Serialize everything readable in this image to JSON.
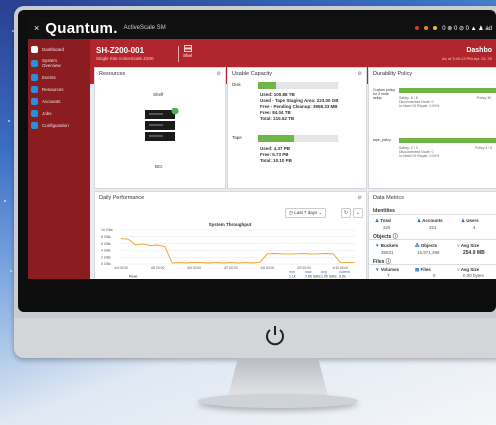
{
  "app": {
    "brand": "Quantum.",
    "product": "ActiveScale SM",
    "close_glyph": "×",
    "status_text": "0 ⊗ 0 ⊘ 0 ▲ ♟ ad"
  },
  "sidebar": {
    "items": [
      {
        "label": "Dashboard",
        "icon": "dashboard-icon"
      },
      {
        "label": "System Overview",
        "icon": "system-icon"
      },
      {
        "label": "Events",
        "icon": "events-icon"
      },
      {
        "label": "Resources",
        "icon": "resources-icon"
      },
      {
        "label": "Accounts",
        "icon": "accounts-icon"
      },
      {
        "label": "Jobs",
        "icon": "jobs-icon"
      },
      {
        "label": "Configuration",
        "icon": "config-icon"
      }
    ]
  },
  "header": {
    "hostname": "SH-Z200-001",
    "subtitle": "Single Site ActiveScale Z200",
    "shelf_label": "Shel",
    "page_title": "Dashbo",
    "as_of": "As of 3:40:13 PM Apr 13, 20"
  },
  "resources": {
    "title": "Resources",
    "unit_label": "Shelf",
    "device_label": "BCI"
  },
  "capacity": {
    "title": "Usable Capacity",
    "disk_label": "Disk",
    "disk_used_fraction": 0.22,
    "disk_lines": [
      "Used: 100.88 TB",
      "Used - Tape Staging Area: 223.00 GB",
      "Free - Pending Cleanup: 3958.33 MB",
      "Free: 84.04 TB",
      "Total: 215.52 TB"
    ],
    "tape_label": "Tape",
    "tape_used_fraction": 0.45,
    "tape_lines": [
      "Used: 4.37 PB",
      "Free: 5.73 PB",
      "Total: 10.10 PB"
    ]
  },
  "durability": {
    "title": "Durability Policy",
    "row1_label": "Custom policy for 3 node setup",
    "row1_detail": [
      "Safety: 6 / 8",
      "Disconnected Node: 0",
      "In-Need Of Repair: 0.00%"
    ],
    "row1_right": "Policy 30",
    "row2_label": "tape_policy",
    "row2_detail": [
      "Safety: 2 / 3",
      "Disconnected Node: 0",
      "In-Need Of Repair: 0.00%"
    ],
    "row2_right": "Policy 4 / 6"
  },
  "performance": {
    "title": "Daily Performance",
    "range_label": "Last 7 days",
    "chart_title": "System Throughput",
    "summary_headers": [
      "min",
      "max",
      "avg",
      "current"
    ],
    "summary_row": {
      "name": "Read",
      "values": [
        "1.1k",
        "7.65 GB/s",
        "1.05 GB/s",
        "0.9x"
      ]
    }
  },
  "metrics": {
    "title": "Data Metrics",
    "identities_label": "Identities",
    "identities": [
      {
        "label": "Total",
        "value": "325"
      },
      {
        "label": "Accounts",
        "value": "321"
      },
      {
        "label": "Users",
        "value": "4"
      }
    ],
    "objects_label": "Objects",
    "objects": [
      {
        "label": "Buckets",
        "value": "35631"
      },
      {
        "label": "Objects",
        "value": "15,971,398"
      },
      {
        "label": "Avg Size",
        "value": "254.9 MB"
      }
    ],
    "files_label": "Files",
    "files": [
      {
        "label": "Volumes",
        "value": "7"
      },
      {
        "label": "Files",
        "value": "0"
      },
      {
        "label": "Avg Size",
        "value": "0.00 bytes"
      }
    ]
  },
  "chart_data": {
    "type": "line",
    "title": "System Throughput",
    "xlabel": "",
    "ylabel": "",
    "x_ticks": [
      "4/4 00:00",
      "4/5 00:00",
      "4/6 00:00",
      "4/7 00:00",
      "4/8 00:00",
      "4/9 00:00",
      "4/10 00:00"
    ],
    "y_ticks": [
      "10 GBs",
      "8 GBs",
      "6 GBs",
      "4 GBs",
      "2 GBs",
      "0 GBs"
    ],
    "ylim": [
      0,
      10
    ],
    "series": [
      {
        "name": "Read",
        "color": "#f0a020",
        "x": [
          0,
          0.2,
          0.4,
          0.6,
          0.8,
          1.0,
          1.2,
          1.4,
          1.6,
          1.8,
          2.0,
          2.2,
          2.4,
          2.6,
          2.8,
          3.0,
          3.2,
          3.4,
          3.6,
          3.8,
          4.0,
          4.2,
          4.4,
          4.6,
          4.8,
          5.0,
          5.2,
          5.4,
          5.6,
          5.8,
          6.0,
          6.2,
          6.4
        ],
        "values": [
          7.5,
          7.3,
          5.6,
          5.9,
          5.4,
          5.6,
          5.1,
          0.3,
          0.4,
          0.3,
          0.5,
          0.4,
          0.3,
          0.4,
          0.3,
          0.4,
          0.3,
          0.4,
          0.3,
          0.5,
          3.0,
          3.1,
          3.0,
          2.9,
          3.0,
          3.1,
          2.9,
          3.0,
          3.1,
          3.0,
          0.5,
          0.4,
          0.5
        ]
      }
    ]
  }
}
